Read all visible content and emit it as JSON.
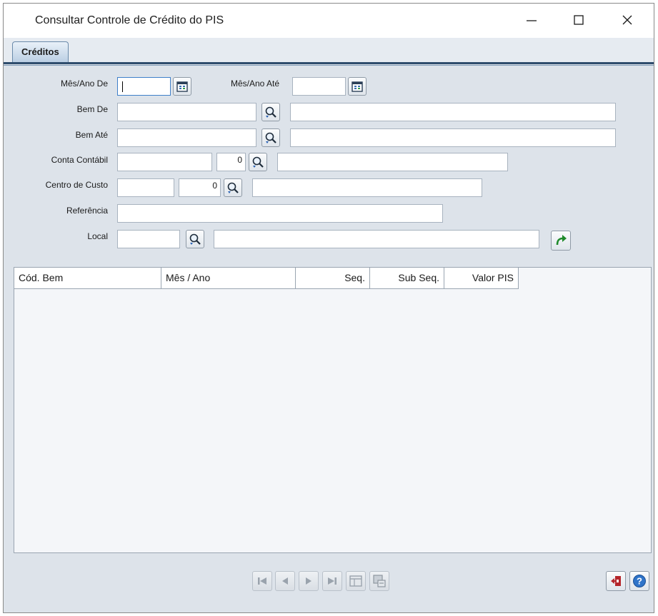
{
  "window": {
    "title": "Consultar Controle de Crédito do PIS",
    "minimize_glyph": "—",
    "maximize_glyph": "☐",
    "close_glyph": "✕"
  },
  "tabs": [
    {
      "label": "Créditos",
      "selected": true
    }
  ],
  "form": {
    "mes_ano_de": {
      "label": "Mês/Ano De",
      "value": ""
    },
    "mes_ano_ate": {
      "label": "Mês/Ano Até",
      "value": ""
    },
    "bem_de": {
      "label": "Bem De",
      "value": "",
      "description": ""
    },
    "bem_ate": {
      "label": "Bem Até",
      "value": "",
      "description": ""
    },
    "conta_contabil": {
      "label": "Conta Contábil",
      "value": "",
      "digit": "0",
      "description": ""
    },
    "centro_custo": {
      "label": "Centro de Custo",
      "value": "",
      "digit": "0",
      "description": ""
    },
    "referencia": {
      "label": "Referência",
      "value": ""
    },
    "local": {
      "label": "Local",
      "value": "",
      "description": ""
    }
  },
  "grid": {
    "columns": [
      "Cód. Bem",
      "Mês / Ano",
      "Seq.",
      "Sub Seq.",
      "Valor PIS"
    ],
    "rows": []
  },
  "icons": {
    "calendar": "calendar-icon",
    "search": "search-magnifier-icon",
    "execute": "green-curved-arrow-icon",
    "nav": [
      "first-record-icon",
      "previous-record-icon",
      "next-record-icon",
      "last-record-icon",
      "grid-view-icon",
      "export-grid-icon"
    ],
    "exit": "exit-door-icon",
    "help": "help-question-icon"
  },
  "colors": {
    "window_bg": "#dde3ea",
    "tab_accent": "#2f4d6d",
    "execute_green": "#1e8a2a",
    "help_blue": "#2f74c9",
    "exit_red": "#b5262b"
  }
}
